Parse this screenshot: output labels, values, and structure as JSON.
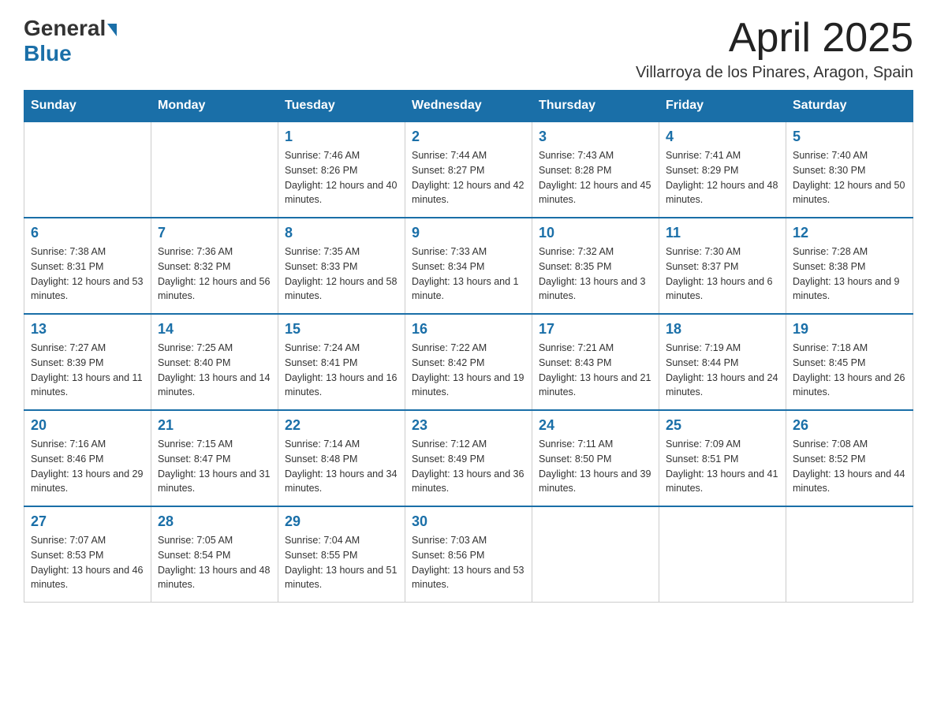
{
  "header": {
    "logo_general": "General",
    "logo_blue": "Blue",
    "title": "April 2025",
    "subtitle": "Villarroya de los Pinares, Aragon, Spain"
  },
  "weekdays": [
    "Sunday",
    "Monday",
    "Tuesday",
    "Wednesday",
    "Thursday",
    "Friday",
    "Saturday"
  ],
  "weeks": [
    [
      {
        "day": "",
        "sunrise": "",
        "sunset": "",
        "daylight": ""
      },
      {
        "day": "",
        "sunrise": "",
        "sunset": "",
        "daylight": ""
      },
      {
        "day": "1",
        "sunrise": "Sunrise: 7:46 AM",
        "sunset": "Sunset: 8:26 PM",
        "daylight": "Daylight: 12 hours and 40 minutes."
      },
      {
        "day": "2",
        "sunrise": "Sunrise: 7:44 AM",
        "sunset": "Sunset: 8:27 PM",
        "daylight": "Daylight: 12 hours and 42 minutes."
      },
      {
        "day": "3",
        "sunrise": "Sunrise: 7:43 AM",
        "sunset": "Sunset: 8:28 PM",
        "daylight": "Daylight: 12 hours and 45 minutes."
      },
      {
        "day": "4",
        "sunrise": "Sunrise: 7:41 AM",
        "sunset": "Sunset: 8:29 PM",
        "daylight": "Daylight: 12 hours and 48 minutes."
      },
      {
        "day": "5",
        "sunrise": "Sunrise: 7:40 AM",
        "sunset": "Sunset: 8:30 PM",
        "daylight": "Daylight: 12 hours and 50 minutes."
      }
    ],
    [
      {
        "day": "6",
        "sunrise": "Sunrise: 7:38 AM",
        "sunset": "Sunset: 8:31 PM",
        "daylight": "Daylight: 12 hours and 53 minutes."
      },
      {
        "day": "7",
        "sunrise": "Sunrise: 7:36 AM",
        "sunset": "Sunset: 8:32 PM",
        "daylight": "Daylight: 12 hours and 56 minutes."
      },
      {
        "day": "8",
        "sunrise": "Sunrise: 7:35 AM",
        "sunset": "Sunset: 8:33 PM",
        "daylight": "Daylight: 12 hours and 58 minutes."
      },
      {
        "day": "9",
        "sunrise": "Sunrise: 7:33 AM",
        "sunset": "Sunset: 8:34 PM",
        "daylight": "Daylight: 13 hours and 1 minute."
      },
      {
        "day": "10",
        "sunrise": "Sunrise: 7:32 AM",
        "sunset": "Sunset: 8:35 PM",
        "daylight": "Daylight: 13 hours and 3 minutes."
      },
      {
        "day": "11",
        "sunrise": "Sunrise: 7:30 AM",
        "sunset": "Sunset: 8:37 PM",
        "daylight": "Daylight: 13 hours and 6 minutes."
      },
      {
        "day": "12",
        "sunrise": "Sunrise: 7:28 AM",
        "sunset": "Sunset: 8:38 PM",
        "daylight": "Daylight: 13 hours and 9 minutes."
      }
    ],
    [
      {
        "day": "13",
        "sunrise": "Sunrise: 7:27 AM",
        "sunset": "Sunset: 8:39 PM",
        "daylight": "Daylight: 13 hours and 11 minutes."
      },
      {
        "day": "14",
        "sunrise": "Sunrise: 7:25 AM",
        "sunset": "Sunset: 8:40 PM",
        "daylight": "Daylight: 13 hours and 14 minutes."
      },
      {
        "day": "15",
        "sunrise": "Sunrise: 7:24 AM",
        "sunset": "Sunset: 8:41 PM",
        "daylight": "Daylight: 13 hours and 16 minutes."
      },
      {
        "day": "16",
        "sunrise": "Sunrise: 7:22 AM",
        "sunset": "Sunset: 8:42 PM",
        "daylight": "Daylight: 13 hours and 19 minutes."
      },
      {
        "day": "17",
        "sunrise": "Sunrise: 7:21 AM",
        "sunset": "Sunset: 8:43 PM",
        "daylight": "Daylight: 13 hours and 21 minutes."
      },
      {
        "day": "18",
        "sunrise": "Sunrise: 7:19 AM",
        "sunset": "Sunset: 8:44 PM",
        "daylight": "Daylight: 13 hours and 24 minutes."
      },
      {
        "day": "19",
        "sunrise": "Sunrise: 7:18 AM",
        "sunset": "Sunset: 8:45 PM",
        "daylight": "Daylight: 13 hours and 26 minutes."
      }
    ],
    [
      {
        "day": "20",
        "sunrise": "Sunrise: 7:16 AM",
        "sunset": "Sunset: 8:46 PM",
        "daylight": "Daylight: 13 hours and 29 minutes."
      },
      {
        "day": "21",
        "sunrise": "Sunrise: 7:15 AM",
        "sunset": "Sunset: 8:47 PM",
        "daylight": "Daylight: 13 hours and 31 minutes."
      },
      {
        "day": "22",
        "sunrise": "Sunrise: 7:14 AM",
        "sunset": "Sunset: 8:48 PM",
        "daylight": "Daylight: 13 hours and 34 minutes."
      },
      {
        "day": "23",
        "sunrise": "Sunrise: 7:12 AM",
        "sunset": "Sunset: 8:49 PM",
        "daylight": "Daylight: 13 hours and 36 minutes."
      },
      {
        "day": "24",
        "sunrise": "Sunrise: 7:11 AM",
        "sunset": "Sunset: 8:50 PM",
        "daylight": "Daylight: 13 hours and 39 minutes."
      },
      {
        "day": "25",
        "sunrise": "Sunrise: 7:09 AM",
        "sunset": "Sunset: 8:51 PM",
        "daylight": "Daylight: 13 hours and 41 minutes."
      },
      {
        "day": "26",
        "sunrise": "Sunrise: 7:08 AM",
        "sunset": "Sunset: 8:52 PM",
        "daylight": "Daylight: 13 hours and 44 minutes."
      }
    ],
    [
      {
        "day": "27",
        "sunrise": "Sunrise: 7:07 AM",
        "sunset": "Sunset: 8:53 PM",
        "daylight": "Daylight: 13 hours and 46 minutes."
      },
      {
        "day": "28",
        "sunrise": "Sunrise: 7:05 AM",
        "sunset": "Sunset: 8:54 PM",
        "daylight": "Daylight: 13 hours and 48 minutes."
      },
      {
        "day": "29",
        "sunrise": "Sunrise: 7:04 AM",
        "sunset": "Sunset: 8:55 PM",
        "daylight": "Daylight: 13 hours and 51 minutes."
      },
      {
        "day": "30",
        "sunrise": "Sunrise: 7:03 AM",
        "sunset": "Sunset: 8:56 PM",
        "daylight": "Daylight: 13 hours and 53 minutes."
      },
      {
        "day": "",
        "sunrise": "",
        "sunset": "",
        "daylight": ""
      },
      {
        "day": "",
        "sunrise": "",
        "sunset": "",
        "daylight": ""
      },
      {
        "day": "",
        "sunrise": "",
        "sunset": "",
        "daylight": ""
      }
    ]
  ]
}
